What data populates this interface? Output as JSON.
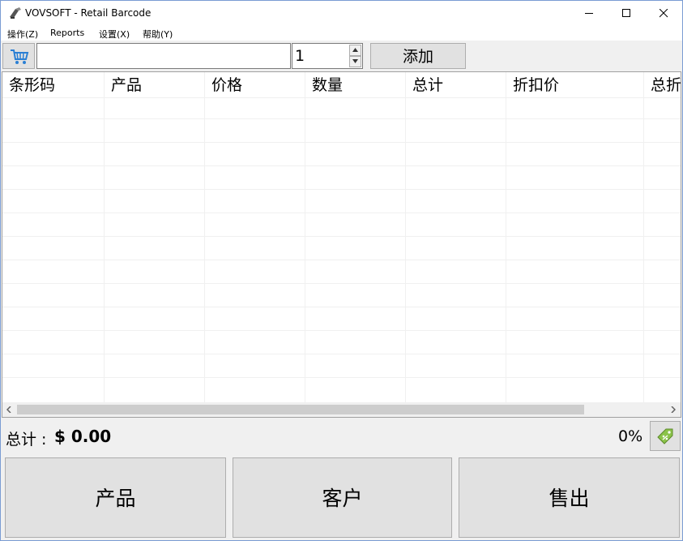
{
  "window": {
    "title": "VOVSOFT - Retail Barcode"
  },
  "menu": [
    {
      "label": "操作(Z)"
    },
    {
      "label": "Reports"
    },
    {
      "label": "设置(X)"
    },
    {
      "label": "帮助(Y)"
    }
  ],
  "toolbar": {
    "barcode_value": "",
    "quantity": "1",
    "add_label": "添加"
  },
  "table": {
    "columns": [
      "条形码",
      "产品",
      "价格",
      "数量",
      "总计",
      "折扣价",
      "总折"
    ],
    "rows": []
  },
  "summary": {
    "total_label": "总计 :",
    "total_value": "$ 0.00",
    "discount_percent": "0%"
  },
  "actions": {
    "products_label": "产品",
    "customers_label": "客户",
    "sell_label": "售出"
  },
  "colors": {
    "accent": "#0078d7",
    "tag_green": "#8bc34a"
  },
  "icons": {
    "app": "barcode-scanner-icon",
    "cart": "shopping-cart-icon",
    "discount": "price-tag-icon"
  }
}
